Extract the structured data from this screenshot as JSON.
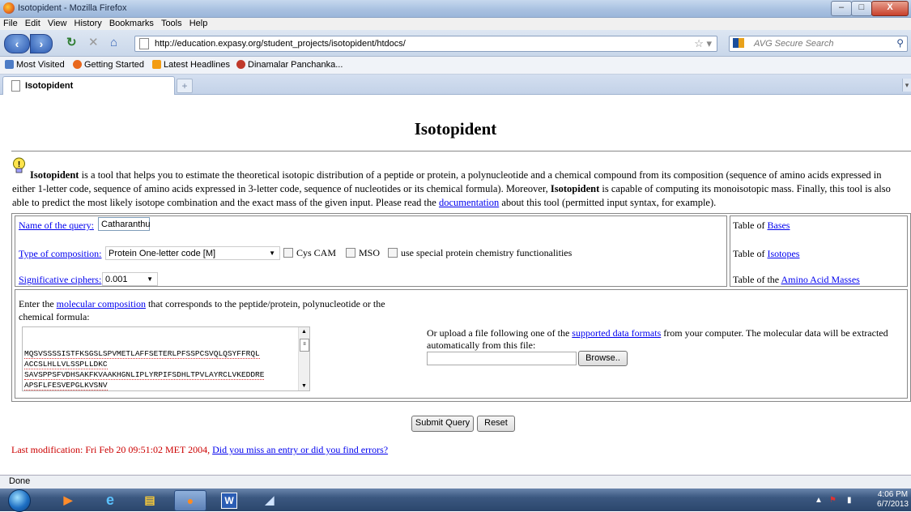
{
  "window": {
    "title": "Isotopident - Mozilla Firefox",
    "controls": {
      "minimize": "–",
      "maximize": "□",
      "close": "X"
    }
  },
  "menu": [
    "File",
    "Edit",
    "View",
    "History",
    "Bookmarks",
    "Tools",
    "Help"
  ],
  "nav": {
    "url": "http://education.expasy.org/student_projects/isotopident/htdocs/",
    "search_placeholder": "AVG Secure Search"
  },
  "bookmarks": [
    {
      "label": "Most Visited",
      "icon": "bookmark-star-icon",
      "color": "#4d7cc6"
    },
    {
      "label": "Getting Started",
      "icon": "firefox-icon",
      "color": "#e8671c"
    },
    {
      "label": "Latest Headlines",
      "icon": "rss-icon",
      "color": "#f39c12"
    },
    {
      "label": "Dinamalar Panchanka...",
      "icon": "site-icon",
      "color": "#c0392b"
    }
  ],
  "tab": {
    "label": "Isotopident",
    "new_tab": "+"
  },
  "page": {
    "title": "Isotopident",
    "intro": {
      "name": "Isotopident",
      "text1": " is a tool that helps you to estimate the theoretical isotopic distribution of a peptide or protein, a polynucleotide and a chemical compound from its composition (sequence of amino acids expressed in either 1-letter code, sequence of amino acids expressed in 3-letter code, sequence of nucleotides or its chemical formula). Moreover, ",
      "name2": "Isotopident",
      "text2": " is capable of computing its monoisotopic mass. Finally, this tool is also able to predict the most likely isotope combination and the exact mass of the given input. Please read the ",
      "doc_link": "documentation",
      "text3": " about this tool (permitted input syntax, for example)."
    },
    "form": {
      "query_label": "Name of the query:",
      "query_value": "Catharanthu",
      "composition_label": "Type of composition:",
      "composition_value": "Protein One-letter code [M]",
      "cys_cam": "Cys CAM",
      "mso": "MSO",
      "special": "use special protein chemistry functionalities",
      "ciphers_label": "Significative ciphers:",
      "ciphers_value": "0.001",
      "tables": {
        "bases_prefix": "Table of ",
        "bases_link": "Bases",
        "isotopes_prefix": "Table of ",
        "isotopes_link": "Isotopes",
        "amino_prefix": "Table of the ",
        "amino_link": "Amino Acid Masses"
      },
      "enter_prefix": "Enter the ",
      "enter_link": "molecular composition",
      "enter_suffix": " that corresponds to the peptide/protein, polynucleotide or the chemical formula:",
      "sequence_lines": [
        "MQSVSSSSISTFKSGSLSPVMETLAFFSETERLPFSSPCSVQLQSYFFRQL",
        "ACCSLHLLVLSSPLLDKC",
        "SAVSPPSFVDHSAKFKVAAKHGNLIPLYRPIFSDHLTPVLAYRCLVKEDDRE",
        "APSFLFESVEPGLKVSNV"
      ],
      "upload_prefix": "Or upload a file following one of the ",
      "upload_link": "supported data formats",
      "upload_suffix": " from your computer. The molecular data will be extracted automatically from this file:",
      "browse": "Browse..",
      "submit": "Submit Query",
      "reset": "Reset"
    },
    "last_mod_text": "Last modification: Fri Feb 20 09:51:02 MET 2004, ",
    "last_mod_link": "Did you miss an entry or did you find errors?"
  },
  "status": "Done",
  "taskbar": {
    "time": "4:06 PM",
    "date": "6/7/2013"
  }
}
